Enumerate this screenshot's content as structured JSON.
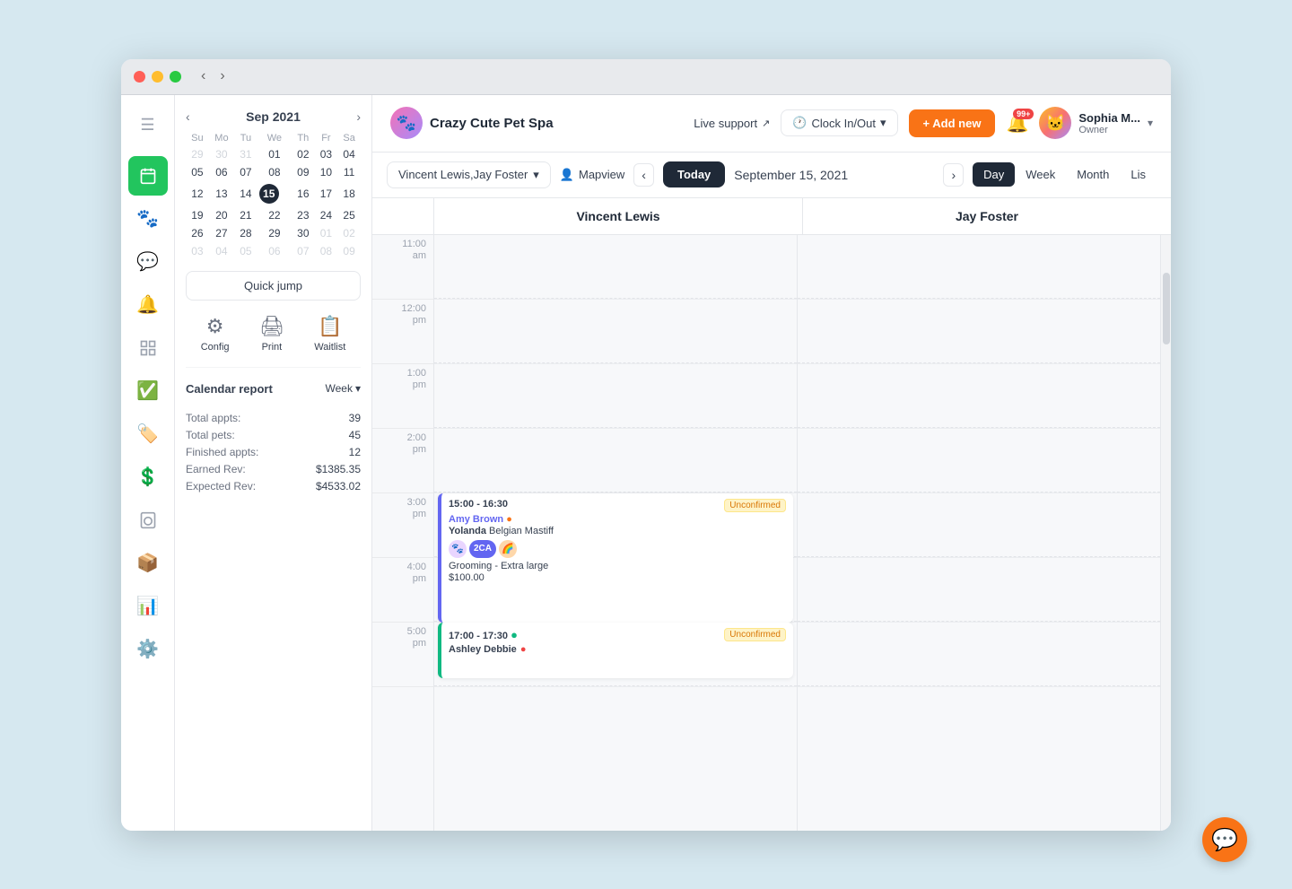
{
  "window": {
    "title": "Crazy Cute Pet Spa"
  },
  "brand": {
    "name": "Crazy Cute Pet Spa",
    "logo_emoji": "🐾"
  },
  "topbar": {
    "live_support": "Live support",
    "clock_in_out": "Clock In/Out",
    "add_new": "+ Add new",
    "notif_badge": "99+",
    "user_name": "Sophia M...",
    "user_role": "Owner"
  },
  "sidebar": {
    "items": [
      {
        "id": "menu",
        "icon": "☰",
        "label": "Menu"
      },
      {
        "id": "calendar",
        "icon": "📅",
        "label": "Calendar",
        "active": true
      },
      {
        "id": "pets",
        "icon": "🐾",
        "label": "Pets"
      },
      {
        "id": "chat",
        "icon": "💬",
        "label": "Chat"
      },
      {
        "id": "alerts",
        "icon": "🔔",
        "label": "Alerts"
      },
      {
        "id": "reports",
        "icon": "📊",
        "label": "Reports"
      },
      {
        "id": "checkin",
        "icon": "✅",
        "label": "Check In"
      },
      {
        "id": "tags",
        "icon": "🏷️",
        "label": "Tags"
      },
      {
        "id": "billing",
        "icon": "💰",
        "label": "Billing"
      },
      {
        "id": "laundry",
        "icon": "👕",
        "label": "Laundry"
      },
      {
        "id": "storage",
        "icon": "📦",
        "label": "Storage"
      },
      {
        "id": "analytics",
        "icon": "📈",
        "label": "Analytics"
      },
      {
        "id": "settings",
        "icon": "⚙️",
        "label": "Settings"
      }
    ]
  },
  "mini_calendar": {
    "month_year": "Sep 2021",
    "days_header": [
      "Su",
      "Mo",
      "Tu",
      "We",
      "Th",
      "Fr",
      "Sa"
    ],
    "weeks": [
      [
        {
          "d": "29",
          "o": true
        },
        {
          "d": "30",
          "o": true
        },
        {
          "d": "31",
          "o": true
        },
        {
          "d": "01"
        },
        {
          "d": "02"
        },
        {
          "d": "03"
        },
        {
          "d": "04"
        }
      ],
      [
        {
          "d": "05"
        },
        {
          "d": "06"
        },
        {
          "d": "07"
        },
        {
          "d": "08"
        },
        {
          "d": "09"
        },
        {
          "d": "10"
        },
        {
          "d": "11"
        }
      ],
      [
        {
          "d": "12"
        },
        {
          "d": "13"
        },
        {
          "d": "14"
        },
        {
          "d": "15",
          "today": true
        },
        {
          "d": "16"
        },
        {
          "d": "17"
        },
        {
          "d": "18"
        }
      ],
      [
        {
          "d": "19"
        },
        {
          "d": "20"
        },
        {
          "d": "21"
        },
        {
          "d": "22"
        },
        {
          "d": "23"
        },
        {
          "d": "24"
        },
        {
          "d": "25"
        }
      ],
      [
        {
          "d": "26"
        },
        {
          "d": "27"
        },
        {
          "d": "28"
        },
        {
          "d": "29"
        },
        {
          "d": "30"
        },
        {
          "d": "01",
          "o": true
        },
        {
          "d": "02",
          "o": true
        }
      ],
      [
        {
          "d": "03",
          "o": true
        },
        {
          "d": "04",
          "o": true
        },
        {
          "d": "05",
          "o": true
        },
        {
          "d": "06",
          "o": true
        },
        {
          "d": "07",
          "o": true
        },
        {
          "d": "08",
          "o": true
        },
        {
          "d": "09",
          "o": true
        }
      ]
    ]
  },
  "quick_jump": {
    "label": "Quick jump"
  },
  "action_icons": [
    {
      "id": "config",
      "icon": "⚙",
      "label": "Config"
    },
    {
      "id": "print",
      "icon": "🖨",
      "label": "Print"
    },
    {
      "id": "waitlist",
      "icon": "📋",
      "label": "Waitlist"
    }
  ],
  "calendar_report": {
    "title": "Calendar report",
    "period": "Week",
    "stats": [
      {
        "label": "Total appts:",
        "value": "39"
      },
      {
        "label": "Total pets:",
        "value": "45"
      },
      {
        "label": "Finished appts:",
        "value": "12"
      },
      {
        "label": "Earned Rev:",
        "value": "$1385.35"
      },
      {
        "label": "Expected Rev:",
        "value": "$4533.02"
      }
    ]
  },
  "cal_toolbar": {
    "staff_filter": "Vincent Lewis,Jay Foster",
    "mapview": "Mapview",
    "today": "Today",
    "date": "September 15, 2021",
    "views": [
      "Day",
      "Week",
      "Month",
      "List"
    ],
    "active_view": "Day"
  },
  "cal_grid": {
    "staff_columns": [
      "Vincent Lewis",
      "Jay Foster"
    ],
    "time_slots": [
      {
        "time": "11:00\nam"
      },
      {
        "time": "12:00\npm"
      },
      {
        "time": "1:00\npm"
      },
      {
        "time": "2:00\npm"
      },
      {
        "time": "3:00\npm"
      },
      {
        "time": "4:00\npm"
      },
      {
        "time": "5:00\npm"
      }
    ]
  },
  "appointments": [
    {
      "id": "appt1",
      "column": 0,
      "time": "15:00 - 16:30",
      "status": "Unconfirmed",
      "client": "Amy Brown",
      "client_info_icon": true,
      "pet": "Yolanda",
      "breed": "Belgian Mastiff",
      "icons": [
        {
          "type": "avatar",
          "color": "#a855f7",
          "text": "🐾"
        },
        {
          "type": "badge",
          "color": "#6366f1",
          "text": "2CA"
        },
        {
          "type": "avatar",
          "color": "#f97316",
          "text": "🌈"
        }
      ],
      "service": "Grooming - Extra large",
      "price": "$100.00",
      "slot_start": 4,
      "offset_top": 0,
      "height": 144
    },
    {
      "id": "appt2",
      "column": 0,
      "time": "17:00 - 17:30",
      "status": "Unconfirmed",
      "client": "Ashley Debbie",
      "client_info_icon": true,
      "green_dot": true,
      "slot_start": 6,
      "offset_top": 0,
      "height": 60
    }
  ],
  "chat_widget": {
    "icon": "💬"
  }
}
